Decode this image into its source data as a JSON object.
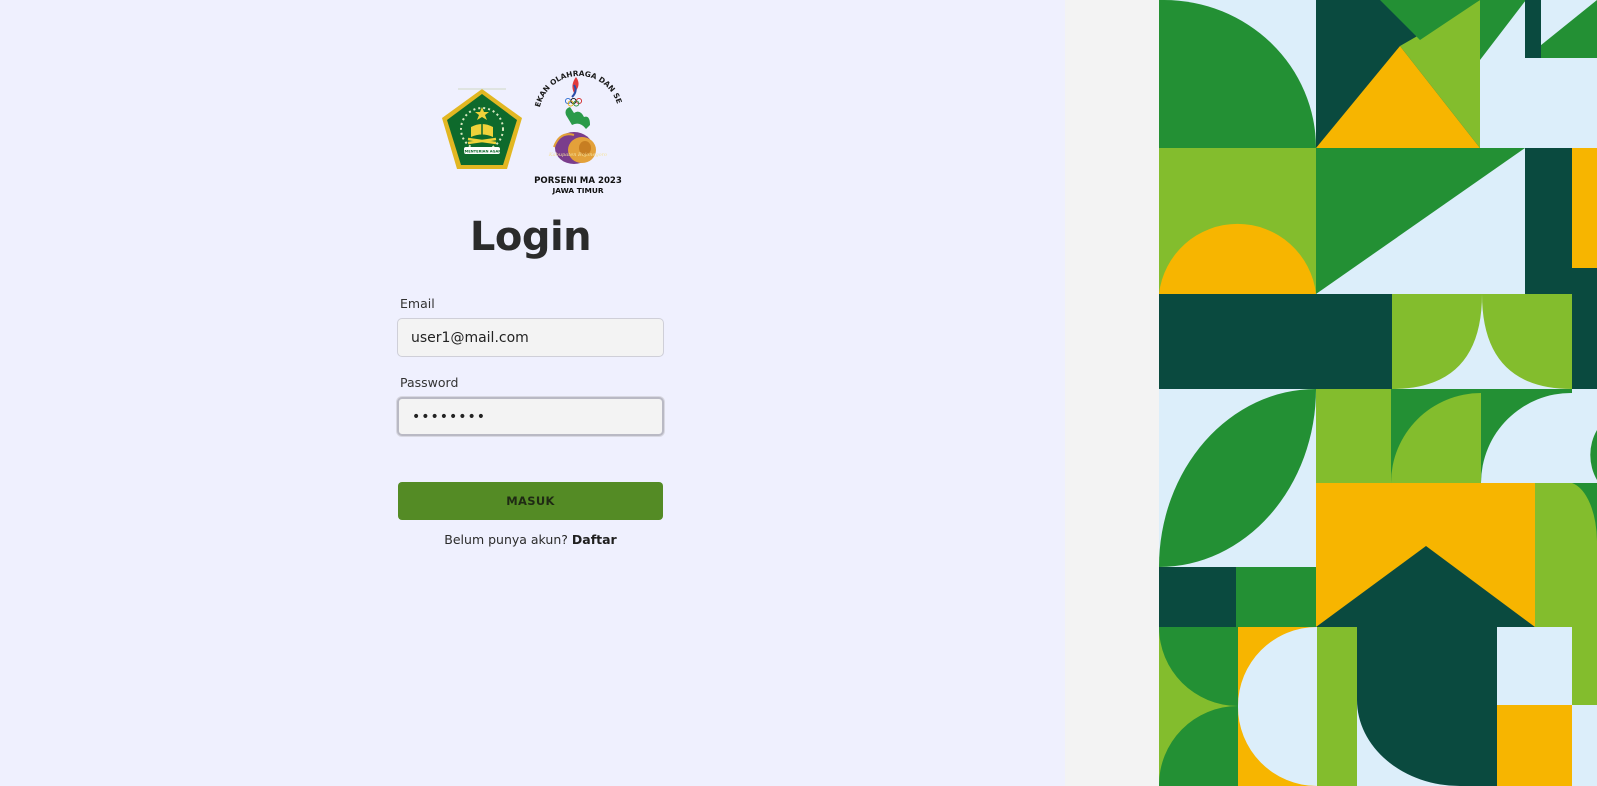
{
  "logos": {
    "kemenag": {
      "icon": "kemenag-emblem-icon",
      "caption": "KEMENTERIAN AGAMA"
    },
    "porseni": {
      "icon": "porseni-logo-icon",
      "arc_text": "PEKAN OLAHRAGA DAN SENI",
      "script_text": "Kabupaten Bojonegoro",
      "line1": "PORSENI MA 2023",
      "line2": "JAWA TIMUR"
    }
  },
  "login": {
    "title": "Login",
    "email_label": "Email",
    "email_value": "user1@mail.com",
    "password_label": "Password",
    "password_value": "password",
    "submit_label": "MASUK",
    "register_prompt": "Belum punya akun?",
    "register_link": "Daftar"
  },
  "colors": {
    "left_bg": "#eff0fe",
    "button": "#548b25",
    "pattern_dark_green": "#0a4a3f",
    "pattern_green": "#239034",
    "pattern_lime": "#83bd2d",
    "pattern_yellow": "#f7b500",
    "pattern_light_blue": "#dceefa"
  }
}
